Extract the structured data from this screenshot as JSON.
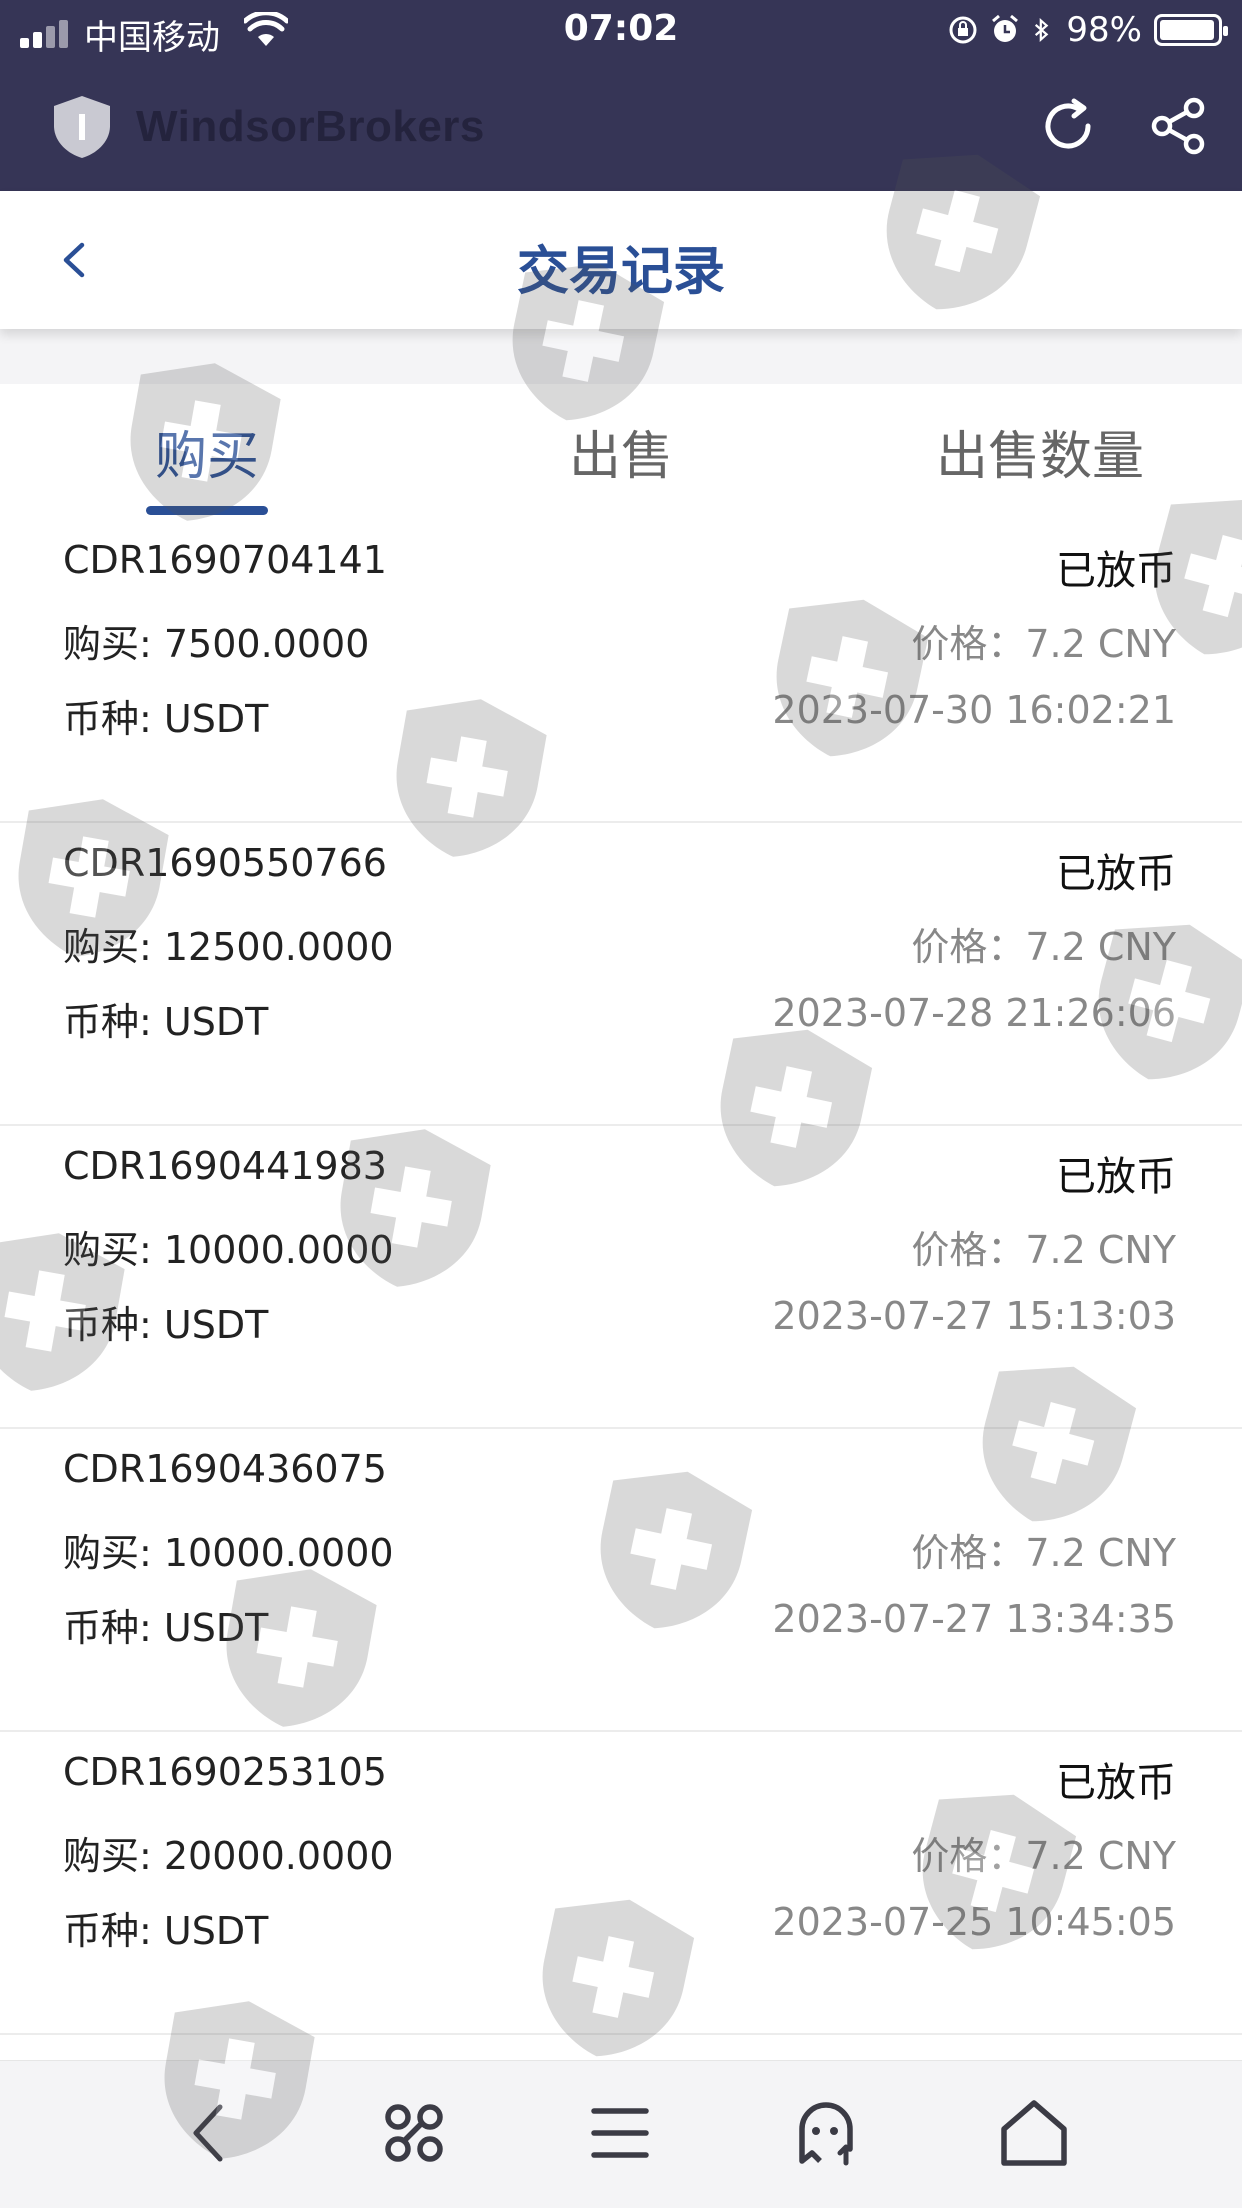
{
  "status_bar": {
    "carrier": "中国移动",
    "time": "07:02",
    "battery": "98%"
  },
  "header": {
    "brand": "WindsorBrokers",
    "icons": [
      "refresh-icon",
      "share-icon"
    ]
  },
  "navbar": {
    "title": "交易记录",
    "back_icon": "chevron-left-icon"
  },
  "tabs": [
    {
      "label": "购买",
      "active": true
    },
    {
      "label": "出售",
      "active": false
    },
    {
      "label": "出售数量",
      "active": false
    }
  ],
  "records": [
    {
      "id": "CDR1690704141",
      "status": "已放币",
      "amount": "购买: 7500.0000",
      "price": "价格：7.2 CNY",
      "currency": "币种: USDT",
      "time": "2023-07-30 16:02:21"
    },
    {
      "id": "CDR1690550766",
      "status": "已放币",
      "amount": "购买: 12500.0000",
      "price": "价格：7.2 CNY",
      "currency": "币种: USDT",
      "time": "2023-07-28 21:26:06"
    },
    {
      "id": "CDR1690441983",
      "status": "已放币",
      "amount": "购买: 10000.0000",
      "price": "价格：7.2 CNY",
      "currency": "币种: USDT",
      "time": "2023-07-27 15:13:03"
    },
    {
      "id": "CDR1690436075",
      "status": "",
      "amount": "购买: 10000.0000",
      "price": "价格：7.2 CNY",
      "currency": "币种: USDT",
      "time": "2023-07-27 13:34:35"
    },
    {
      "id": "CDR1690253105",
      "status": "已放币",
      "amount": "购买: 20000.0000",
      "price": "价格：7.2 CNY",
      "currency": "币种: USDT",
      "time": "2023-07-25 10:45:05"
    }
  ],
  "bottom_bar": {
    "icons": [
      "back-arrow-icon",
      "command-icon",
      "menu-icon",
      "ghost-icon",
      "home-icon"
    ]
  },
  "colors": {
    "header_bg": "#363556",
    "accent": "#2a4f96",
    "muted_text": "#888888"
  }
}
